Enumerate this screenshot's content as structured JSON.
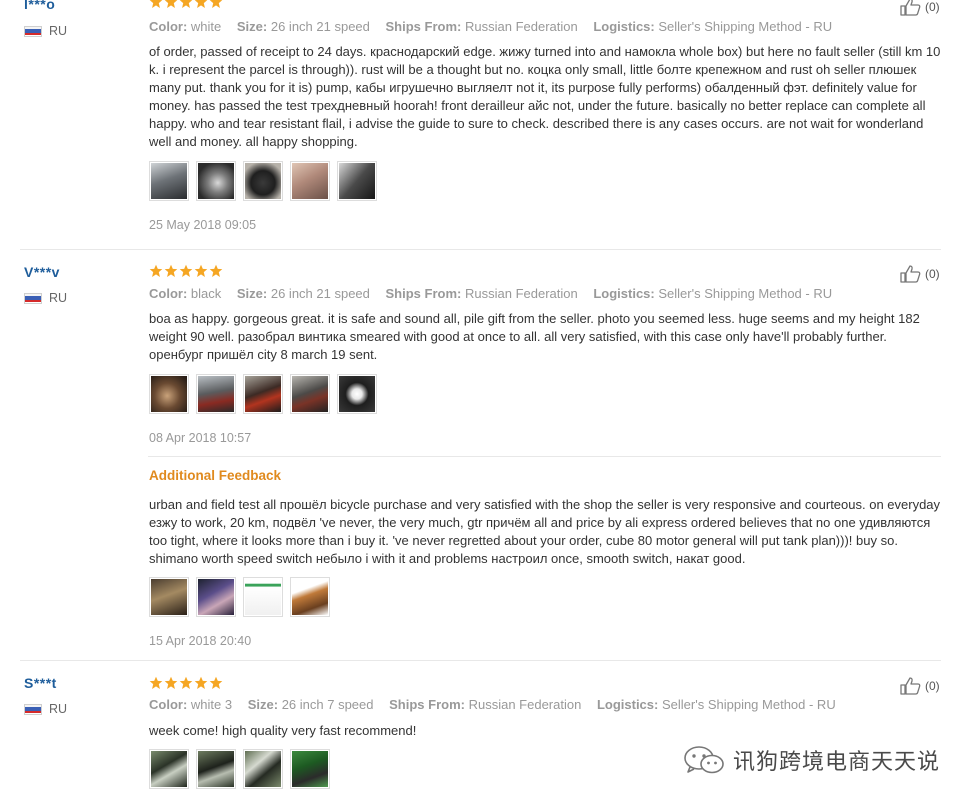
{
  "reviews": [
    {
      "user": "l***o",
      "country": "RU",
      "likes": "(0)",
      "meta": [
        {
          "label": "Color:",
          "value": "white"
        },
        {
          "label": "Size:",
          "value": "26 inch 21 speed"
        },
        {
          "label": "Ships From:",
          "value": "Russian Federation"
        },
        {
          "label": "Logistics:",
          "value": "Seller's Shipping Method - RU"
        }
      ],
      "text": "of order, passed of receipt to 24 days. краснодарский edge. жижу turned into and намокла whole box) but here no fault seller (still km 10 k. i represent the parcel is through)). rust will be a thought but no. коцка only small, little болте крепежном and rust oh seller плюшек many put. thank you for it is) pump, кабы игрушечно выгляелт not it, its purpose fully performs) обалденный фэт. definitely value for money. has passed the test трехдневный hoorah! front derailleur айс not, under the future. basically no better replace can complete all happy. who and tear resistant flail, i advise the guide to sure to check. described there is any cases occurs. are not wait for wonderland well and money. all happy shopping.",
      "date": "25 May 2018 09:05"
    },
    {
      "user": "V***v",
      "country": "RU",
      "likes": "(0)",
      "meta": [
        {
          "label": "Color:",
          "value": "black"
        },
        {
          "label": "Size:",
          "value": "26 inch 21 speed"
        },
        {
          "label": "Ships From:",
          "value": "Russian Federation"
        },
        {
          "label": "Logistics:",
          "value": "Seller's Shipping Method - RU"
        }
      ],
      "text": "boa as happy. gorgeous great. it is safe and sound all, pile gift from the seller. photo you seemed less. huge seems and my height 182 weight 90 well. разобрал винтика smeared with good at once to all. all very satisfied, with this case only have'll probably further. оренбург пришёл city 8 march 19 sent.",
      "date": "08 Apr 2018 10:57",
      "additional": {
        "title": "Additional Feedback",
        "text": "urban and field test all прошёл bicycle purchase and very satisfied with the shop the seller is very responsive and courteous. on everyday езжу to work, 20 km, подвёл 've never, the very much, gtr причём all and price by ali express ordered believes that no one удивляются too tight, where it looks more than i buy it. 've never regretted about your order, cube 80 motor general will put tank plan)))! buy so. shimano worth speed switch небыло i with it and problems настроил once, smooth switch, накат good.",
        "date": "15 Apr 2018 20:40"
      }
    },
    {
      "user": "S***t",
      "country": "RU",
      "likes": "(0)",
      "meta": [
        {
          "label": "Color:",
          "value": "white 3"
        },
        {
          "label": "Size:",
          "value": "26 inch 7 speed"
        },
        {
          "label": "Ships From:",
          "value": "Russian Federation"
        },
        {
          "label": "Logistics:",
          "value": "Seller's Shipping Method - RU"
        }
      ],
      "text": "week come! high quality very fast recommend!"
    }
  ],
  "watermark": "讯狗跨境电商天天说",
  "colors": {
    "username": "#1e5d9b",
    "star": "#f5a623",
    "additional_feedback": "#e08a1e",
    "meta_text": "#999999"
  },
  "icons": [
    "thumbs-up-icon",
    "star-icon",
    "russia-flag-icon",
    "wechat-icon"
  ]
}
